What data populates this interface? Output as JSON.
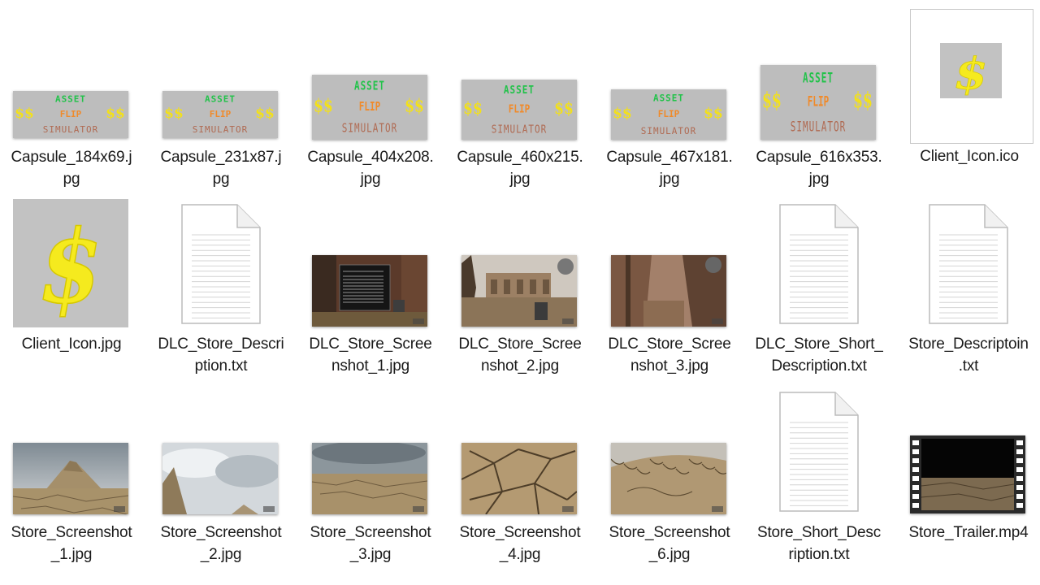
{
  "files": [
    {
      "label": "Capsule_184x69.j\npg",
      "type": "capsule",
      "kind": "image"
    },
    {
      "label": "Capsule_231x87.j\npg",
      "type": "capsule",
      "kind": "image"
    },
    {
      "label": "Capsule_404x208.\njpg",
      "type": "capsule",
      "kind": "image"
    },
    {
      "label": "Capsule_460x215.\njpg",
      "type": "capsule",
      "kind": "image"
    },
    {
      "label": "Capsule_467x181.\njpg",
      "type": "capsule",
      "kind": "image"
    },
    {
      "label": "Capsule_616x353.\njpg",
      "type": "capsule",
      "kind": "image"
    },
    {
      "label": "Client_Icon.ico",
      "type": "ico",
      "kind": "icon",
      "selected": true
    },
    {
      "label": "Client_Icon.jpg",
      "type": "dollar",
      "kind": "image"
    },
    {
      "label": "DLC_Store_Descri\nption.txt",
      "type": "text",
      "kind": "document"
    },
    {
      "label": "DLC_Store_Scree\nnshot_1.jpg",
      "type": "game-dialog",
      "kind": "image"
    },
    {
      "label": "DLC_Store_Scree\nnshot_2.jpg",
      "type": "game-ruins",
      "kind": "image"
    },
    {
      "label": "DLC_Store_Scree\nnshot_3.jpg",
      "type": "game-canyon",
      "kind": "image"
    },
    {
      "label": "DLC_Store_Short_\nDescription.txt",
      "type": "text",
      "kind": "document"
    },
    {
      "label": "Store_Descriptoin\n.txt",
      "type": "text",
      "kind": "document"
    },
    {
      "label": "Store_Screenshot\n_1.jpg",
      "type": "desert-mound",
      "kind": "image"
    },
    {
      "label": "Store_Screenshot\n_2.jpg",
      "type": "desert-sky",
      "kind": "image"
    },
    {
      "label": "Store_Screenshot\n_3.jpg",
      "type": "desert-flat",
      "kind": "image"
    },
    {
      "label": "Store_Screenshot\n_4.jpg",
      "type": "cracked-close",
      "kind": "image"
    },
    {
      "label": "Store_Screenshot\n_6.jpg",
      "type": "cracked-hill",
      "kind": "image"
    },
    {
      "label": "Store_Short_Desc\nription.txt",
      "type": "text",
      "kind": "document"
    },
    {
      "label": "Store_Trailer.mp4",
      "type": "video",
      "kind": "video"
    }
  ],
  "logo_text": {
    "line1": "ASSET",
    "line2": "FLIP",
    "line3": "SIMULATOR",
    "currency": "$$"
  },
  "colors": {
    "logo_green": "#22c24a",
    "logo_orange": "#f08a2a",
    "logo_yellow": "#f2e01c",
    "logo_brown": "#b06a52",
    "capsule_bg": "#bdbdbd",
    "label_text": "#1a1a1a"
  }
}
